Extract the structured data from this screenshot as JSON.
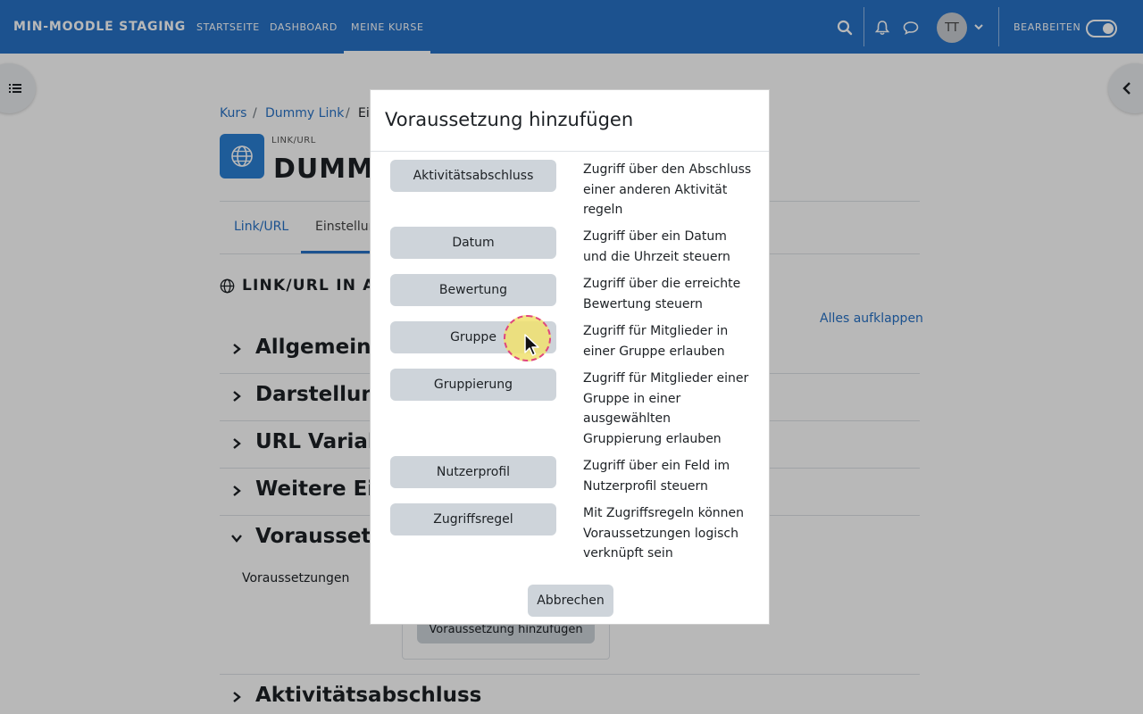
{
  "navbar": {
    "brand": "MIN-MOODLE STAGING",
    "links": [
      "STARTSEITE",
      "DASHBOARD",
      "MEINE KURSE"
    ],
    "active_link": "MEINE KURSE",
    "avatar_initials": "TT",
    "edit_label": "BEARBEITEN",
    "edit_mode": true,
    "color": "#2872c6"
  },
  "breadcrumb": {
    "items": [
      "Kurs",
      "Dummy Link",
      "Ei"
    ],
    "separator": "/"
  },
  "activity": {
    "type_label": "LINK/URL",
    "title": "DUMM",
    "icon": "globe-icon"
  },
  "tabs": [
    "Link/URL",
    "Einstellun"
  ],
  "section": {
    "heading": "LINK/URL IN A",
    "expand_all": "Alles aufklappen"
  },
  "accordion": [
    {
      "title": "Allgemeine",
      "expanded": false
    },
    {
      "title": "Darstellung",
      "expanded": false
    },
    {
      "title": "URL Variabl",
      "expanded": false
    },
    {
      "title": "Weitere Ein",
      "expanded": false
    },
    {
      "title": "Voraussetzu",
      "expanded": true
    },
    {
      "title": "Aktivitätsabschluss",
      "expanded": false
    }
  ],
  "prerequisites": {
    "label": "Voraussetzungen",
    "add_button": "Voraussetzung hinzufügen"
  },
  "modal": {
    "title": "Voraussetzung hinzufügen",
    "options": [
      {
        "label": "Aktivitätsabschluss",
        "description": "Zugriff über den Abschluss einer anderen Aktivität regeln"
      },
      {
        "label": "Datum",
        "description": "Zugriff über ein Datum und die Uhrzeit steuern"
      },
      {
        "label": "Bewertung",
        "description": "Zugriff über die erreichte Bewertung steuern"
      },
      {
        "label": "Gruppe",
        "description": "Zugriff für Mitglieder in einer Gruppe erlauben"
      },
      {
        "label": "Gruppierung",
        "description": "Zugriff für Mitglieder einer Gruppe in einer ausgewählten Gruppierung erlauben"
      },
      {
        "label": "Nutzerprofil",
        "description": "Zugriff über ein Feld im Nutzerprofil steuern"
      },
      {
        "label": "Zugriffsregel",
        "description": "Mit Zugriffsregeln können Voraussetzungen logisch verknüpft sein"
      }
    ],
    "cancel": "Abbrechen"
  }
}
